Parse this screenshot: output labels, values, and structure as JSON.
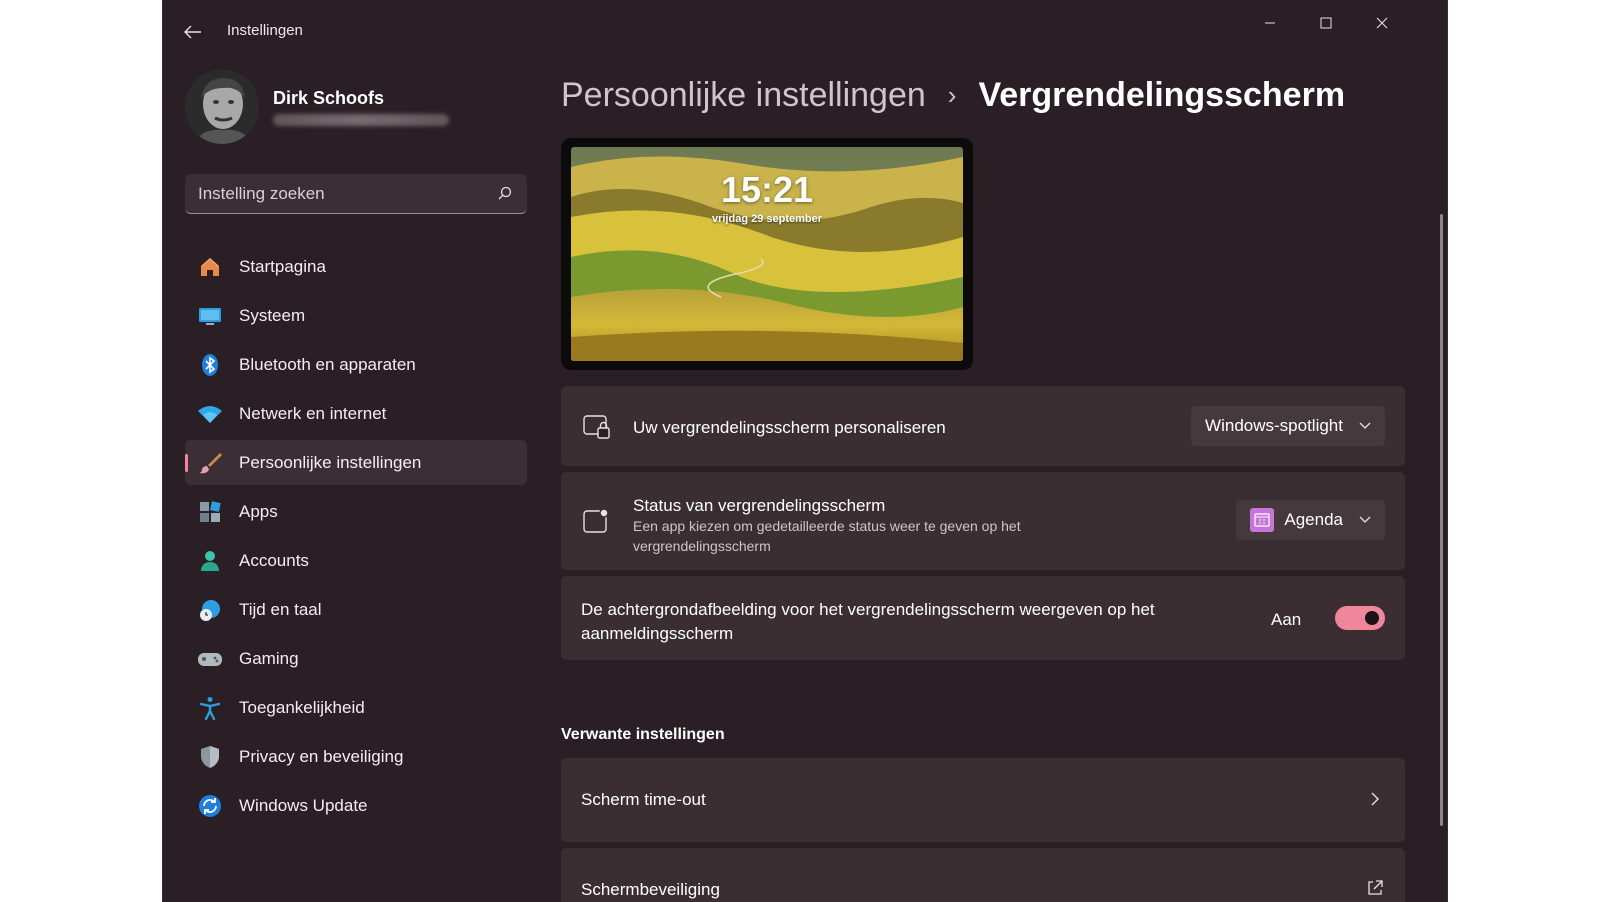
{
  "window": {
    "title": "Instellingen"
  },
  "user": {
    "name": "Dirk Schoofs"
  },
  "search": {
    "placeholder": "Instelling zoeken"
  },
  "nav": {
    "items": [
      {
        "label": "Startpagina",
        "icon": "home-icon"
      },
      {
        "label": "Systeem",
        "icon": "monitor-icon"
      },
      {
        "label": "Bluetooth en apparaten",
        "icon": "bluetooth-icon"
      },
      {
        "label": "Netwerk en internet",
        "icon": "wifi-icon"
      },
      {
        "label": "Persoonlijke instellingen",
        "icon": "brush-icon",
        "active": true
      },
      {
        "label": "Apps",
        "icon": "apps-icon"
      },
      {
        "label": "Accounts",
        "icon": "person-icon"
      },
      {
        "label": "Tijd en taal",
        "icon": "globe-clock-icon"
      },
      {
        "label": "Gaming",
        "icon": "gamepad-icon"
      },
      {
        "label": "Toegankelijkheid",
        "icon": "accessibility-icon"
      },
      {
        "label": "Privacy en beveiliging",
        "icon": "shield-icon"
      },
      {
        "label": "Windows Update",
        "icon": "update-icon"
      }
    ]
  },
  "breadcrumb": {
    "parent": "Persoonlijke instellingen",
    "separator": "›",
    "current": "Vergrendelingsscherm"
  },
  "preview": {
    "time": "15:21",
    "date": "vrijdag 29 september"
  },
  "settings": {
    "personalize": {
      "title": "Uw vergrendelingsscherm personaliseren",
      "value": "Windows-spotlight"
    },
    "status": {
      "title": "Status van vergrendelingsscherm",
      "description": "Een app kiezen om gedetailleerde status weer te geven op het vergrendelingsscherm",
      "value": "Agenda"
    },
    "background": {
      "title": "De achtergrondafbeelding voor het vergrendelingsscherm weergeven op het aanmeldingsscherm",
      "state_label": "Aan",
      "on": true
    }
  },
  "related": {
    "title": "Verwante instellingen",
    "items": [
      {
        "label": "Scherm time-out",
        "icon": "chevron-right-icon"
      },
      {
        "label": "Schermbeveiliging",
        "icon": "external-link-icon"
      }
    ]
  },
  "colors": {
    "accent": "#f0869a",
    "background": "#2a1f24",
    "card": "#3a2e33"
  }
}
